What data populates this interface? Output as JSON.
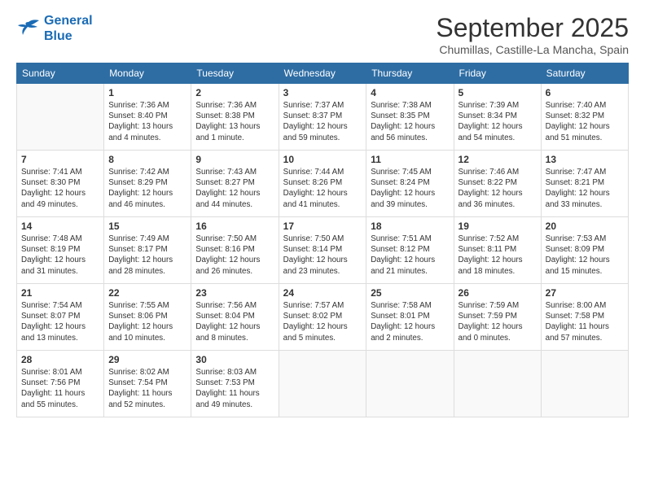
{
  "logo": {
    "line1": "General",
    "line2": "Blue"
  },
  "title": "September 2025",
  "subtitle": "Chumillas, Castille-La Mancha, Spain",
  "weekdays": [
    "Sunday",
    "Monday",
    "Tuesday",
    "Wednesday",
    "Thursday",
    "Friday",
    "Saturday"
  ],
  "weeks": [
    [
      {
        "day": "",
        "content": ""
      },
      {
        "day": "1",
        "content": "Sunrise: 7:36 AM\nSunset: 8:40 PM\nDaylight: 13 hours\nand 4 minutes."
      },
      {
        "day": "2",
        "content": "Sunrise: 7:36 AM\nSunset: 8:38 PM\nDaylight: 13 hours\nand 1 minute."
      },
      {
        "day": "3",
        "content": "Sunrise: 7:37 AM\nSunset: 8:37 PM\nDaylight: 12 hours\nand 59 minutes."
      },
      {
        "day": "4",
        "content": "Sunrise: 7:38 AM\nSunset: 8:35 PM\nDaylight: 12 hours\nand 56 minutes."
      },
      {
        "day": "5",
        "content": "Sunrise: 7:39 AM\nSunset: 8:34 PM\nDaylight: 12 hours\nand 54 minutes."
      },
      {
        "day": "6",
        "content": "Sunrise: 7:40 AM\nSunset: 8:32 PM\nDaylight: 12 hours\nand 51 minutes."
      }
    ],
    [
      {
        "day": "7",
        "content": "Sunrise: 7:41 AM\nSunset: 8:30 PM\nDaylight: 12 hours\nand 49 minutes."
      },
      {
        "day": "8",
        "content": "Sunrise: 7:42 AM\nSunset: 8:29 PM\nDaylight: 12 hours\nand 46 minutes."
      },
      {
        "day": "9",
        "content": "Sunrise: 7:43 AM\nSunset: 8:27 PM\nDaylight: 12 hours\nand 44 minutes."
      },
      {
        "day": "10",
        "content": "Sunrise: 7:44 AM\nSunset: 8:26 PM\nDaylight: 12 hours\nand 41 minutes."
      },
      {
        "day": "11",
        "content": "Sunrise: 7:45 AM\nSunset: 8:24 PM\nDaylight: 12 hours\nand 39 minutes."
      },
      {
        "day": "12",
        "content": "Sunrise: 7:46 AM\nSunset: 8:22 PM\nDaylight: 12 hours\nand 36 minutes."
      },
      {
        "day": "13",
        "content": "Sunrise: 7:47 AM\nSunset: 8:21 PM\nDaylight: 12 hours\nand 33 minutes."
      }
    ],
    [
      {
        "day": "14",
        "content": "Sunrise: 7:48 AM\nSunset: 8:19 PM\nDaylight: 12 hours\nand 31 minutes."
      },
      {
        "day": "15",
        "content": "Sunrise: 7:49 AM\nSunset: 8:17 PM\nDaylight: 12 hours\nand 28 minutes."
      },
      {
        "day": "16",
        "content": "Sunrise: 7:50 AM\nSunset: 8:16 PM\nDaylight: 12 hours\nand 26 minutes."
      },
      {
        "day": "17",
        "content": "Sunrise: 7:50 AM\nSunset: 8:14 PM\nDaylight: 12 hours\nand 23 minutes."
      },
      {
        "day": "18",
        "content": "Sunrise: 7:51 AM\nSunset: 8:12 PM\nDaylight: 12 hours\nand 21 minutes."
      },
      {
        "day": "19",
        "content": "Sunrise: 7:52 AM\nSunset: 8:11 PM\nDaylight: 12 hours\nand 18 minutes."
      },
      {
        "day": "20",
        "content": "Sunrise: 7:53 AM\nSunset: 8:09 PM\nDaylight: 12 hours\nand 15 minutes."
      }
    ],
    [
      {
        "day": "21",
        "content": "Sunrise: 7:54 AM\nSunset: 8:07 PM\nDaylight: 12 hours\nand 13 minutes."
      },
      {
        "day": "22",
        "content": "Sunrise: 7:55 AM\nSunset: 8:06 PM\nDaylight: 12 hours\nand 10 minutes."
      },
      {
        "day": "23",
        "content": "Sunrise: 7:56 AM\nSunset: 8:04 PM\nDaylight: 12 hours\nand 8 minutes."
      },
      {
        "day": "24",
        "content": "Sunrise: 7:57 AM\nSunset: 8:02 PM\nDaylight: 12 hours\nand 5 minutes."
      },
      {
        "day": "25",
        "content": "Sunrise: 7:58 AM\nSunset: 8:01 PM\nDaylight: 12 hours\nand 2 minutes."
      },
      {
        "day": "26",
        "content": "Sunrise: 7:59 AM\nSunset: 7:59 PM\nDaylight: 12 hours\nand 0 minutes."
      },
      {
        "day": "27",
        "content": "Sunrise: 8:00 AM\nSunset: 7:58 PM\nDaylight: 11 hours\nand 57 minutes."
      }
    ],
    [
      {
        "day": "28",
        "content": "Sunrise: 8:01 AM\nSunset: 7:56 PM\nDaylight: 11 hours\nand 55 minutes."
      },
      {
        "day": "29",
        "content": "Sunrise: 8:02 AM\nSunset: 7:54 PM\nDaylight: 11 hours\nand 52 minutes."
      },
      {
        "day": "30",
        "content": "Sunrise: 8:03 AM\nSunset: 7:53 PM\nDaylight: 11 hours\nand 49 minutes."
      },
      {
        "day": "",
        "content": ""
      },
      {
        "day": "",
        "content": ""
      },
      {
        "day": "",
        "content": ""
      },
      {
        "day": "",
        "content": ""
      }
    ]
  ]
}
